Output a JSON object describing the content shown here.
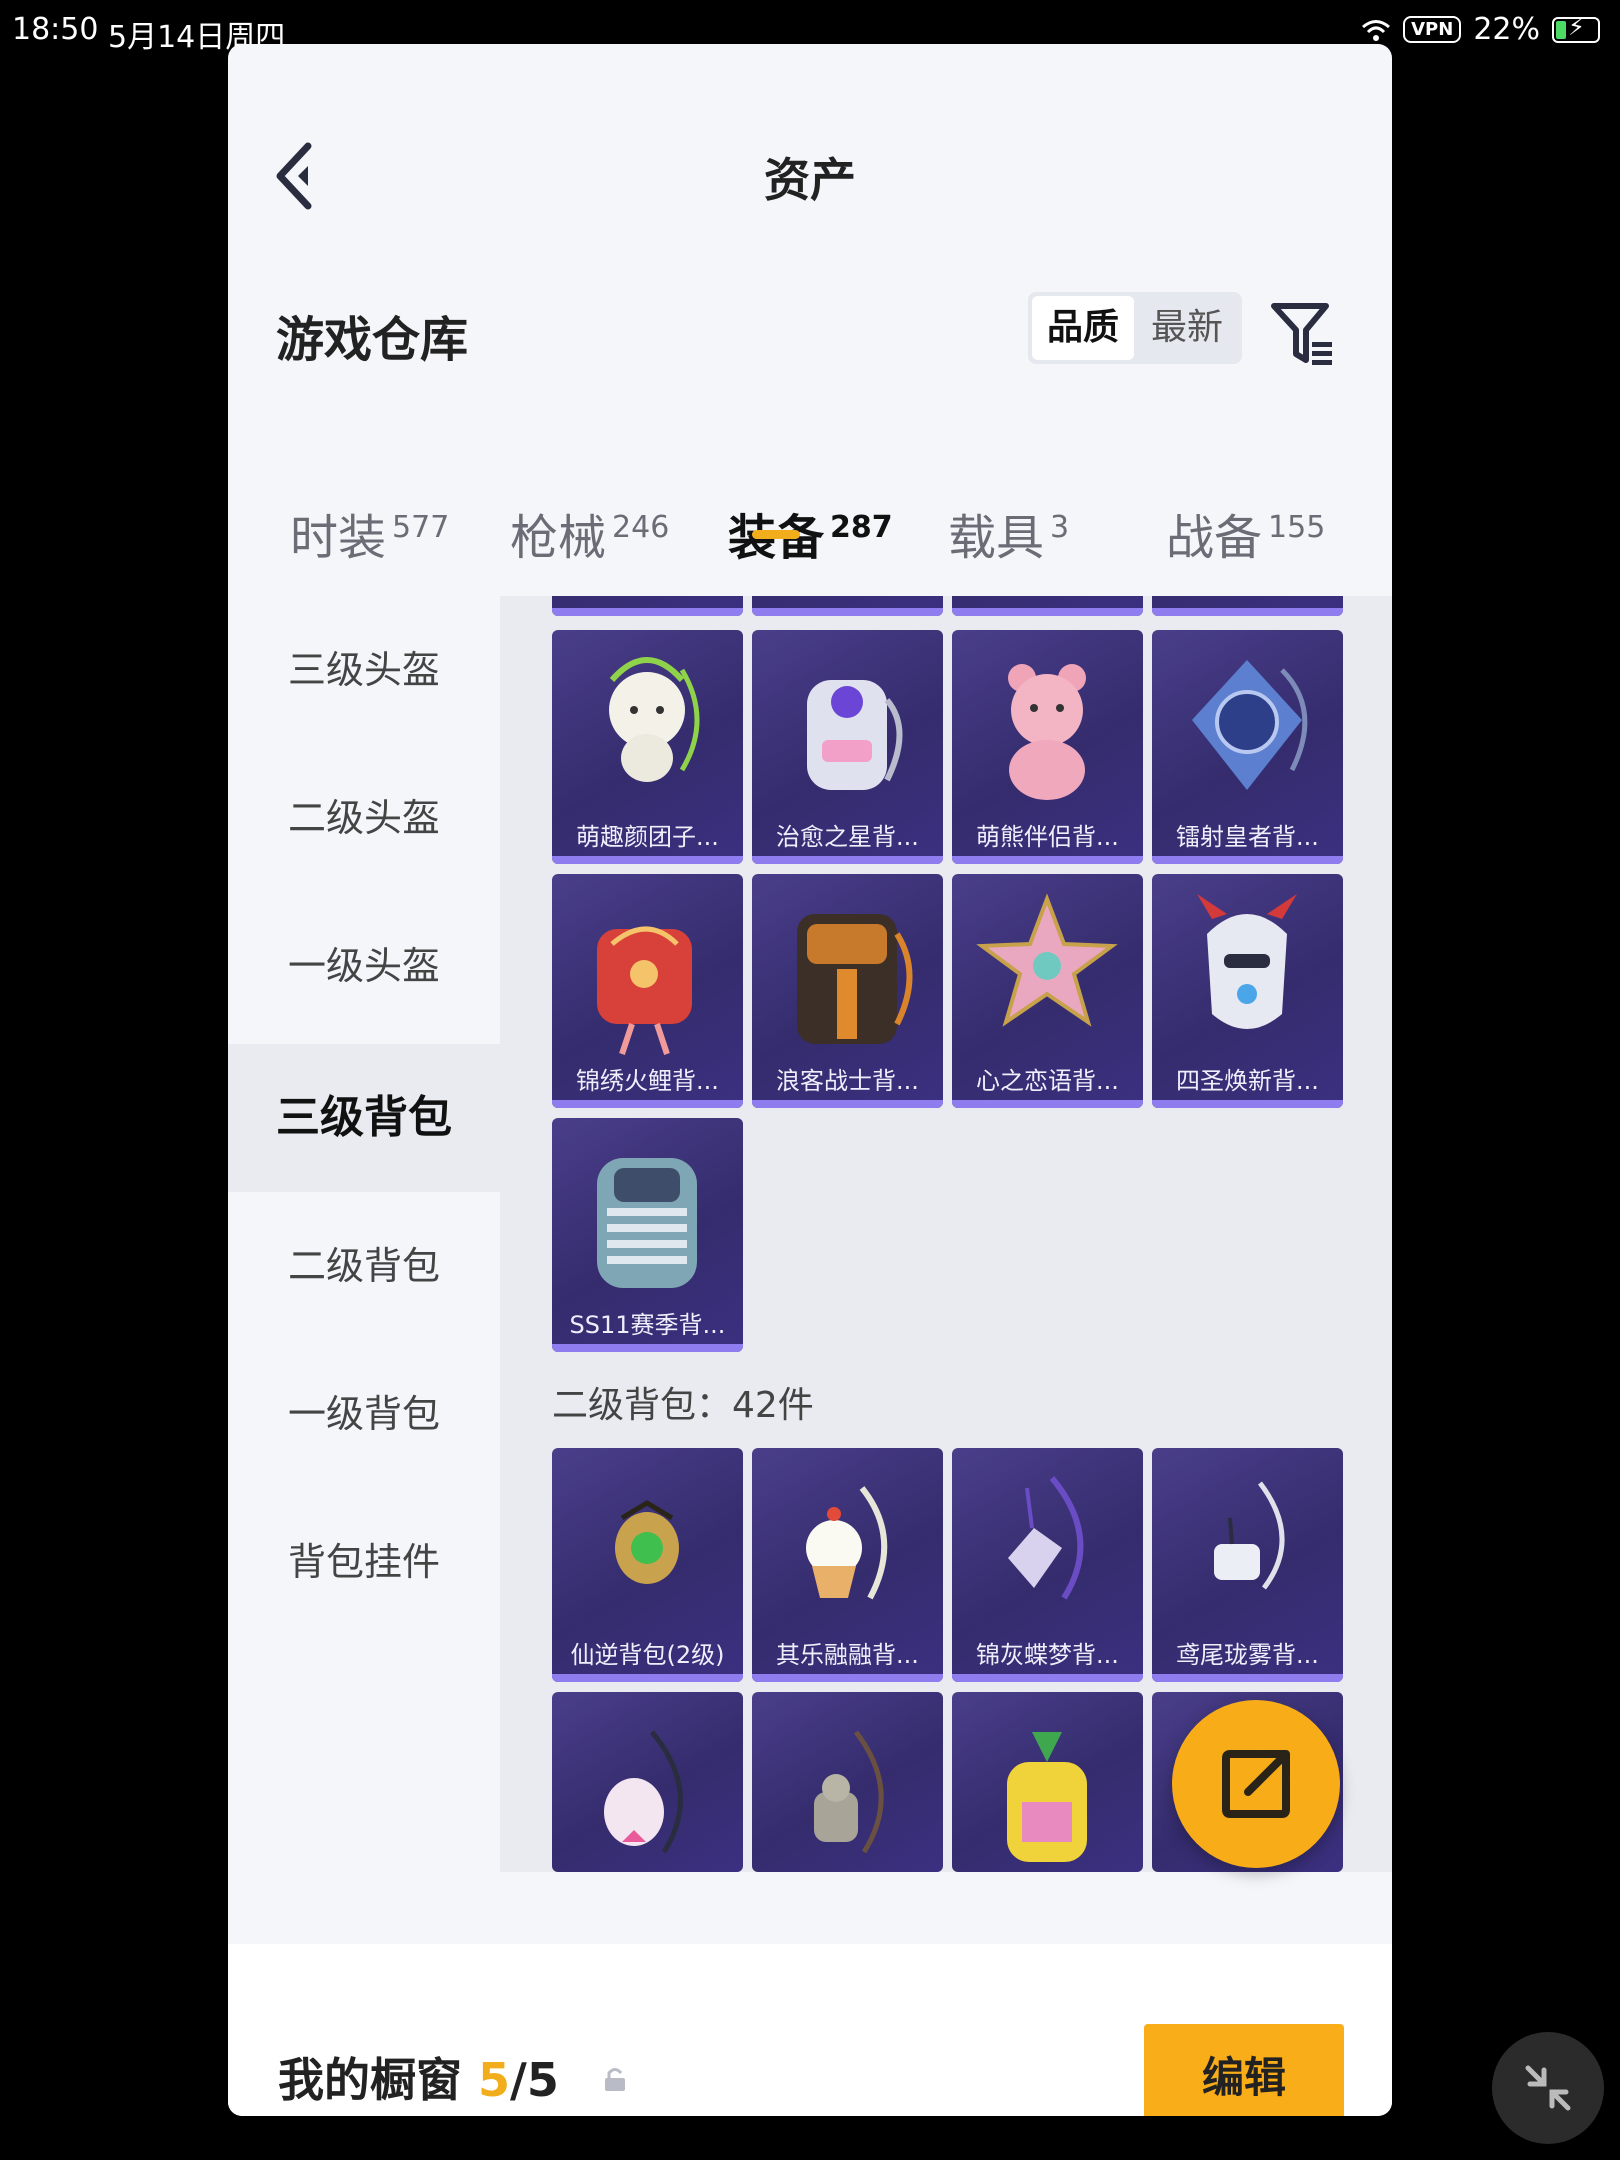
{
  "status_bar": {
    "time": "18:50",
    "date": "5月14日周四",
    "vpn": "VPN",
    "battery": "22%"
  },
  "header": {
    "title": "资产"
  },
  "warehouse": {
    "title": "游戏仓库",
    "sort_options": [
      "品质",
      "最新"
    ]
  },
  "tabs": [
    {
      "label": "时装",
      "count": "577"
    },
    {
      "label": "枪械",
      "count": "246"
    },
    {
      "label": "装备",
      "count": "287"
    },
    {
      "label": "载具",
      "count": "3"
    },
    {
      "label": "战备",
      "count": "155"
    }
  ],
  "sidebar": [
    "三级头盔",
    "二级头盔",
    "一级头盔",
    "三级背包",
    "二级背包",
    "一级背包",
    "背包挂件"
  ],
  "grid_lvl3": [
    "萌趣颜团子...",
    "治愈之星背...",
    "萌熊伴侣背...",
    "镭射皇者背...",
    "锦绣火鲤背...",
    "浪客战士背...",
    "心之恋语背...",
    "四圣焕新背...",
    "SS11赛季背..."
  ],
  "section_lvl2": "二级背包：42件",
  "grid_lvl2": [
    "仙逆背包(2级)",
    "其乐融融背...",
    "锦灰蝶梦背...",
    "鸢尾珑雾背..."
  ],
  "bottom": {
    "showcase": "我的橱窗",
    "count_current": "5",
    "count_total": "/5",
    "edit": "编辑"
  },
  "colors": {
    "accent": "#f2ad1c",
    "card": "#3b3080"
  }
}
